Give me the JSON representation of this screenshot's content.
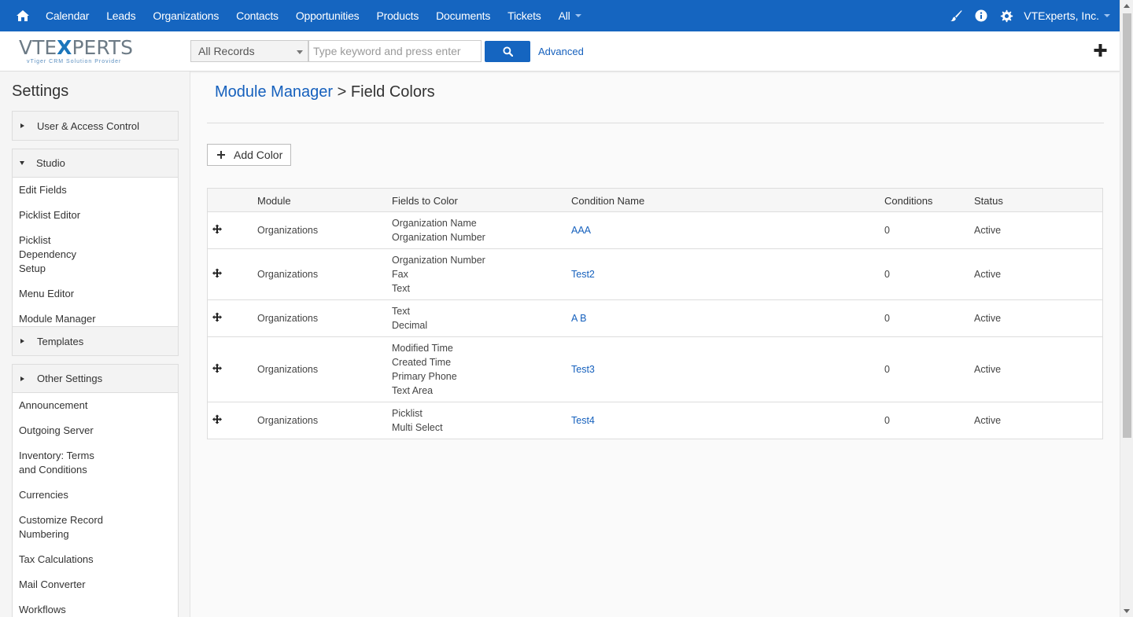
{
  "topnav": {
    "items": [
      "Calendar",
      "Leads",
      "Organizations",
      "Contacts",
      "Opportunities",
      "Products",
      "Documents",
      "Tickets",
      "All"
    ],
    "user": "VTExperts, Inc.",
    "accent": "#1565c0"
  },
  "subbar": {
    "logo_text": "VTEXPERTS",
    "logo_sub": "vTiger CRM Solution Provider",
    "records_select": "All Records",
    "search_placeholder": "Type keyword and press enter",
    "advanced": "Advanced"
  },
  "sidebar": {
    "title": "Settings",
    "sections": [
      {
        "label": "User & Access Control",
        "expanded": false,
        "items": []
      },
      {
        "label": "Studio",
        "expanded": true,
        "items": [
          "Edit Fields",
          "Picklist Editor",
          "Picklist Dependency Setup",
          "Menu Editor",
          "Module Manager"
        ]
      },
      {
        "label": "Templates",
        "expanded": false,
        "items": []
      },
      {
        "label": "Other Settings",
        "expanded": true,
        "items": [
          "Announcement",
          "Outgoing Server",
          "Inventory: Terms and Conditions",
          "Currencies",
          "Customize Record Numbering",
          "Tax Calculations",
          "Mail Converter",
          "Workflows"
        ]
      }
    ]
  },
  "main": {
    "breadcrumb_link": "Module Manager",
    "breadcrumb_sep": ">",
    "breadcrumb_current": "Field Colors",
    "add_button": "Add Color",
    "columns": [
      "Module",
      "Fields to Color",
      "Condition Name",
      "Conditions",
      "Status"
    ],
    "rows": [
      {
        "module": "Organizations",
        "fields": [
          "Organization Name",
          "Organization Number"
        ],
        "condition_name": "AAA",
        "conditions": "0",
        "status": "Active"
      },
      {
        "module": "Organizations",
        "fields": [
          "Organization Number",
          "Fax",
          "Text"
        ],
        "condition_name": "Test2",
        "conditions": "0",
        "status": "Active"
      },
      {
        "module": "Organizations",
        "fields": [
          "Text",
          "Decimal"
        ],
        "condition_name": "A B",
        "conditions": "0",
        "status": "Active"
      },
      {
        "module": "Organizations",
        "fields": [
          "Modified Time",
          "Created Time",
          "Primary Phone",
          "Text Area"
        ],
        "condition_name": "Test3",
        "conditions": "0",
        "status": "Active"
      },
      {
        "module": "Organizations",
        "fields": [
          "Picklist",
          "Multi Select"
        ],
        "condition_name": "Test4",
        "conditions": "0",
        "status": "Active"
      }
    ]
  }
}
